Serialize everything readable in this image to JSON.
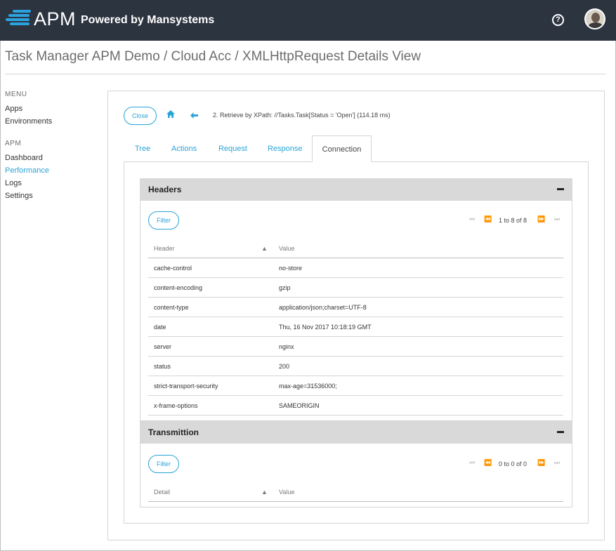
{
  "brand": {
    "app": "APM",
    "tagline": "Powered by Mansystems",
    "accent": "#2ba3e0",
    "topbar_color": "#2c3440"
  },
  "header": {
    "help_icon": "question-circle-icon",
    "avatar_icon": "user-avatar"
  },
  "page": {
    "title": "Task Manager APM Demo / Cloud Acc / XMLHttpRequest Details View"
  },
  "sidebar": {
    "menu_heading": "MENU",
    "menu_items": [
      "Apps",
      "Environments"
    ],
    "apm_heading": "APM",
    "apm_items": [
      "Dashboard",
      "Performance",
      "Logs",
      "Settings"
    ],
    "active": "Performance"
  },
  "toolbar": {
    "close_label": "Close",
    "home_icon": "home-icon",
    "back_icon": "arrow-left-icon",
    "breadcrumb": "2. Retrieve by XPath: //Tasks.Task[Status = 'Open'] (114.18 ms)"
  },
  "tabs": [
    "Tree",
    "Actions",
    "Request",
    "Response",
    "Connection"
  ],
  "active_tab": "Connection",
  "headers_section": {
    "title": "Headers",
    "filter_label": "Filter",
    "pager_text": "1 to 8 of 8",
    "columns": [
      "Header",
      "Value"
    ],
    "rows": [
      [
        "cache-control",
        "no-store"
      ],
      [
        "content-encoding",
        "gzip"
      ],
      [
        "content-type",
        "application/json;charset=UTF-8"
      ],
      [
        "date",
        "Thu, 16 Nov 2017 10:18:19 GMT"
      ],
      [
        "server",
        "nginx"
      ],
      [
        "status",
        "200"
      ],
      [
        "strict-transport-security",
        "max-age=31536000;"
      ],
      [
        "x-frame-options",
        "SAMEORIGIN"
      ]
    ]
  },
  "transmittion_section": {
    "title": "Transmittion",
    "filter_label": "Filter",
    "pager_text": "0 to 0 of 0",
    "columns": [
      "Detail",
      "Value"
    ],
    "rows": []
  }
}
